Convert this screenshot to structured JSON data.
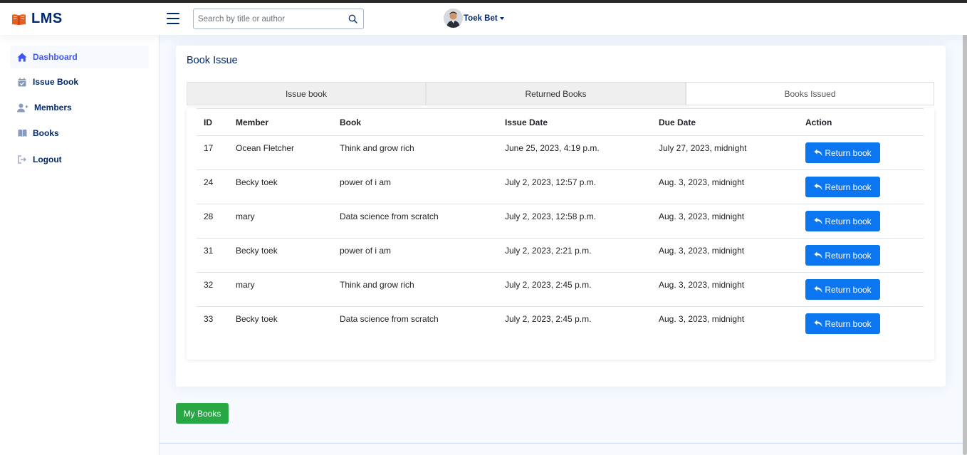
{
  "header": {
    "logo_text": "LMS",
    "search_placeholder": "Search by title or author",
    "user_name": "Toek Bet"
  },
  "sidebar": {
    "items": [
      {
        "label": "Dashboard",
        "icon": "house-icon",
        "active": true
      },
      {
        "label": "Issue Book",
        "icon": "calendar-check-icon"
      },
      {
        "label": "Members",
        "icon": "person-add-icon"
      },
      {
        "label": "Books",
        "icon": "book-icon"
      },
      {
        "label": "Logout",
        "icon": "logout-icon"
      }
    ]
  },
  "main": {
    "title": "Book Issue",
    "tabs": [
      {
        "label": "Issue book"
      },
      {
        "label": "Returned Books"
      },
      {
        "label": "Books Issued",
        "active": true
      }
    ],
    "table": {
      "headers": [
        "ID",
        "Member",
        "Book",
        "Issue Date",
        "Due Date",
        "Action"
      ],
      "rows": [
        {
          "id": "17",
          "member": "Ocean Fletcher",
          "book": "Think and grow rich",
          "issue_date": "June 25, 2023, 4:19 p.m.",
          "due_date": "July 27, 2023, midnight",
          "action": "Return book"
        },
        {
          "id": "24",
          "member": "Becky toek",
          "book": "power of i am",
          "issue_date": "July 2, 2023, 12:57 p.m.",
          "due_date": "Aug. 3, 2023, midnight",
          "action": "Return book"
        },
        {
          "id": "28",
          "member": "mary",
          "book": "Data science from scratch",
          "issue_date": "July 2, 2023, 12:58 p.m.",
          "due_date": "Aug. 3, 2023, midnight",
          "action": "Return book"
        },
        {
          "id": "31",
          "member": "Becky toek",
          "book": "power of i am",
          "issue_date": "July 2, 2023, 2:21 p.m.",
          "due_date": "Aug. 3, 2023, midnight",
          "action": "Return book"
        },
        {
          "id": "32",
          "member": "mary",
          "book": "Think and grow rich",
          "issue_date": "July 2, 2023, 2:45 p.m.",
          "due_date": "Aug. 3, 2023, midnight",
          "action": "Return book"
        },
        {
          "id": "33",
          "member": "Becky toek",
          "book": "Data science from scratch",
          "issue_date": "July 2, 2023, 2:45 p.m.",
          "due_date": "Aug. 3, 2023, midnight",
          "action": "Return book"
        }
      ]
    },
    "my_books_label": "My Books"
  },
  "colors": {
    "brand": "#012970",
    "accent": "#4154f1",
    "primary_button": "#0b76f0",
    "success_button": "#28a745",
    "logo_book": "#e85d1c"
  }
}
